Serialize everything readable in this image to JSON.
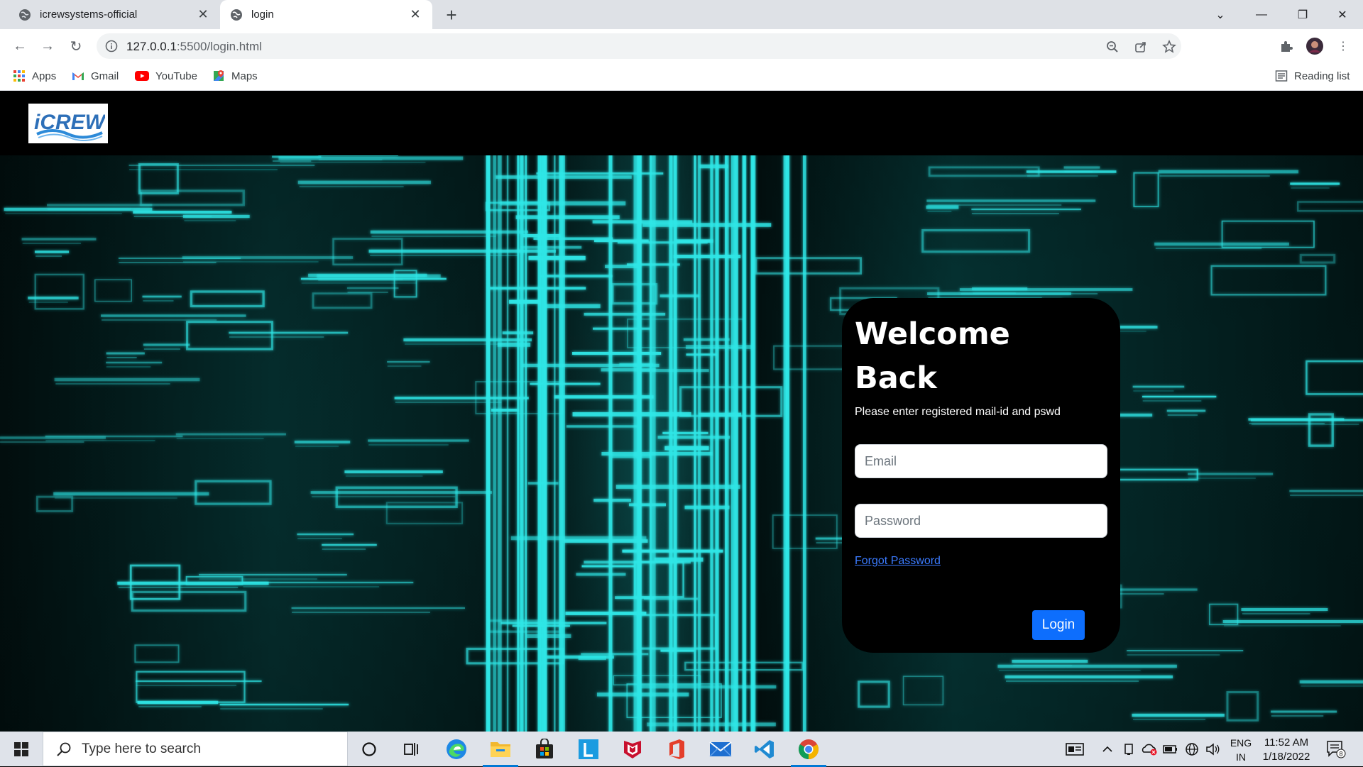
{
  "browser": {
    "tabs": [
      {
        "title": "icrewsystems-official",
        "active": false
      },
      {
        "title": "login",
        "active": true
      }
    ],
    "url_host": "127.0.0.1",
    "url_path": ":5500/login.html",
    "bookmarks": [
      {
        "label": "Apps",
        "icon": "apps-grid-icon"
      },
      {
        "label": "Gmail",
        "icon": "gmail-icon"
      },
      {
        "label": "YouTube",
        "icon": "youtube-icon"
      },
      {
        "label": "Maps",
        "icon": "maps-icon"
      }
    ],
    "reading_list": "Reading list"
  },
  "site": {
    "logo_text": "iCREW",
    "login": {
      "title": "Welcome Back",
      "subtitle": "Please enter registered mail-id and pswd",
      "email_placeholder": "Email",
      "password_placeholder": "Password",
      "forgot_label": "Forgot Password",
      "button_label": "Login"
    }
  },
  "taskbar": {
    "search_placeholder": "Type here to search",
    "lang_line1": "ENG",
    "lang_line2": "IN",
    "time": "11:52 AM",
    "date": "1/18/2022",
    "notification_count": "8"
  },
  "colors": {
    "accent": "#0d6efd",
    "circuit": "#2ee6e6",
    "link": "#3b7bff"
  }
}
